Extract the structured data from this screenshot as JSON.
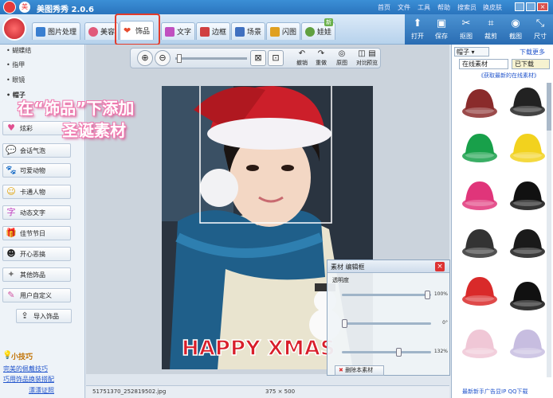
{
  "window": {
    "title": "美图秀秀 2.0.6",
    "menu": [
      "首页",
      "文件",
      "工具",
      "帮助",
      "搜索员",
      "换皮肤"
    ]
  },
  "tabs": [
    {
      "label": "图片处理",
      "color": "#3a7fd0"
    },
    {
      "label": "美容",
      "color": "#e05a7a"
    },
    {
      "label": "饰品",
      "color": "#e64a2e",
      "active": true
    },
    {
      "label": "文字",
      "color": "#c050c0"
    },
    {
      "label": "边框",
      "color": "#d04040"
    },
    {
      "label": "场景",
      "color": "#4070c0"
    },
    {
      "label": "闪图",
      "color": "#e0a020"
    },
    {
      "label": "娃娃",
      "color": "#60a040",
      "badge": "新"
    }
  ],
  "tools": [
    "打开",
    "保存",
    "抠图",
    "裁剪",
    "截图",
    "尺寸"
  ],
  "left_top_items": [
    "蝴蝶结",
    "指甲",
    "眼镜",
    "帽子"
  ],
  "categories": [
    "炫彩",
    "会话气泡",
    "可爱动物",
    "卡通人物",
    "动态文字",
    "佳节节日",
    "开心恶搞",
    "其他饰品",
    "用户自定义",
    "导入饰品"
  ],
  "tips": {
    "title": "小技巧",
    "links": [
      "完美的佩戴技巧",
      "巧用饰品换装搭配",
      "漂漂证照"
    ]
  },
  "viewbar": [
    "撤销",
    "重做",
    "原图",
    "对比",
    "预览"
  ],
  "caption": {
    "line1": "在“饰品”下添加",
    "line2": "圣诞素材"
  },
  "photo": {
    "text": "HAPPY XMAS"
  },
  "material_panel": {
    "header": "素材 编辑框",
    "label": "透明度",
    "opacity": "100%",
    "rotation": "0°",
    "scale": "132%",
    "delete": "删除本素材"
  },
  "status": {
    "filename": "51751370_252819502.jpg",
    "size": "375 × 500"
  },
  "right_panel": {
    "title": "下载更多",
    "tab_online": "在线素材",
    "tab_downloaded": "已下载",
    "dropdown": "帽子",
    "link": "《获取最新的在线素材》",
    "footer": "最新新手广告显IP QQ下载"
  },
  "hats": [
    "red knit cap",
    "black cap",
    "green cap",
    "yellow cap",
    "pink cap",
    "black cap 2",
    "colorful cap",
    "black white cap",
    "santa hat",
    "graduation cap",
    "pink beanie",
    "purple beanie"
  ]
}
